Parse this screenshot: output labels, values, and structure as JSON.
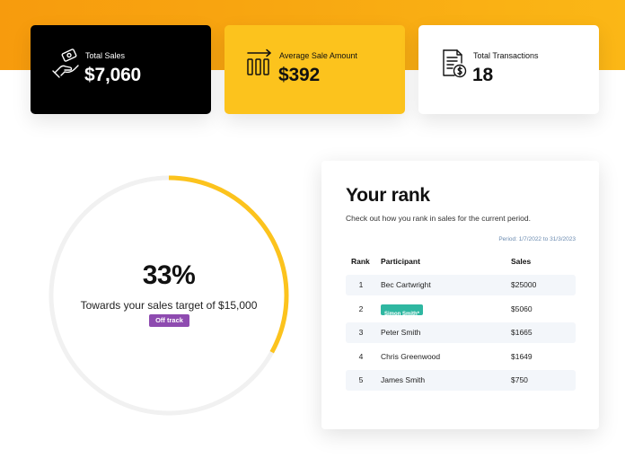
{
  "stats": {
    "total_sales": {
      "label": "Total Sales",
      "value": "$7,060",
      "icon": "money-hand-icon"
    },
    "average_sale": {
      "label": "Average Sale Amount",
      "value": "$392",
      "icon": "bar-chart-arrow-icon"
    },
    "total_transactions": {
      "label": "Total Transactions",
      "value": "18",
      "icon": "invoice-dollar-icon"
    }
  },
  "target": {
    "percent_text": "33%",
    "progress_fraction": 0.33,
    "subtitle": "Towards your sales target of $15,000",
    "status": "Off track"
  },
  "rank": {
    "title": "Your rank",
    "description": "Check out how you rank in sales for the current period.",
    "period": "Period: 1/7/2022 to 31/3/2023",
    "headers": {
      "rank": "Rank",
      "participant": "Participant",
      "sales": "Sales"
    },
    "rows": [
      {
        "rank": "1",
        "participant": "Bec Cartwright",
        "sales": "$25000"
      },
      {
        "rank": "2",
        "participant": "Simon Smith*",
        "sales": "$5060"
      },
      {
        "rank": "3",
        "participant": "Peter Smith",
        "sales": "$1665"
      },
      {
        "rank": "4",
        "participant": "Chris Greenwood",
        "sales": "$1649"
      },
      {
        "rank": "5",
        "participant": "James Smith",
        "sales": "$750"
      }
    ]
  },
  "colors": {
    "accent": "#fcc31d",
    "orange": "#f79b0d",
    "off_track": "#8e4bb0",
    "you": "#2fb7a1",
    "track": "#f1f1f1"
  }
}
